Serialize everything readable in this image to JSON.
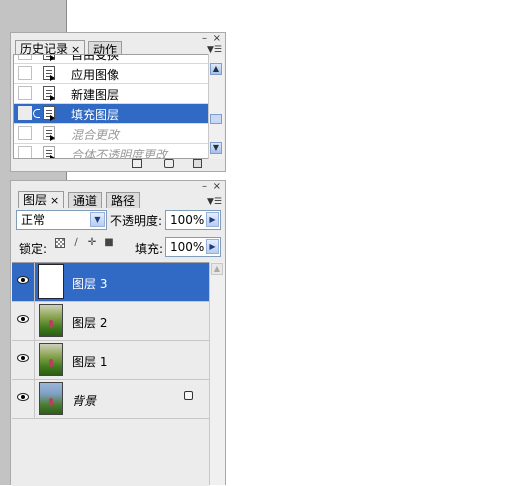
{
  "history_panel": {
    "tabs": [
      {
        "label": "历史记录",
        "close": "×",
        "active": true
      },
      {
        "label": "动作",
        "active": false
      }
    ],
    "items": [
      {
        "label": "自由变换",
        "state": "partial"
      },
      {
        "label": "应用图像",
        "state": "normal"
      },
      {
        "label": "新建图层",
        "state": "normal"
      },
      {
        "label": "填充图层",
        "state": "selected"
      },
      {
        "label": "混合更改",
        "state": "dimmed"
      },
      {
        "label": "合体不透明度更改",
        "state": "dimmed"
      }
    ]
  },
  "layers_panel": {
    "tabs": [
      {
        "label": "图层",
        "close": "×",
        "active": true
      },
      {
        "label": "通道",
        "active": false
      },
      {
        "label": "路径",
        "active": false
      }
    ],
    "blend_mode": "正常",
    "opacity_label": "不透明度:",
    "opacity_value": "100%",
    "lock_label": "锁定:",
    "fill_label": "填充:",
    "fill_value": "100%",
    "layers": [
      {
        "name": "图层 3",
        "visible": true,
        "selected": true,
        "thumbnail": "white"
      },
      {
        "name": "图层 2",
        "visible": true,
        "selected": false,
        "thumbnail": "photo"
      },
      {
        "name": "图层 1",
        "visible": true,
        "selected": false,
        "thumbnail": "photo"
      },
      {
        "name": "背景",
        "visible": true,
        "selected": false,
        "thumbnail": "photo",
        "locked": true
      }
    ]
  },
  "window_controls": {
    "minimize": "–",
    "close": "×"
  },
  "colors": {
    "selection": "#316ac5",
    "panel_bg": "#ececec",
    "workspace": "#c3c3c3"
  },
  "icons": [
    "history-state-icon",
    "eye-icon",
    "lock-icon",
    "brush-icon",
    "move-icon",
    "checkerboard-icon",
    "new-document-icon",
    "camera-icon",
    "trash-icon",
    "panel-menu-icon"
  ]
}
